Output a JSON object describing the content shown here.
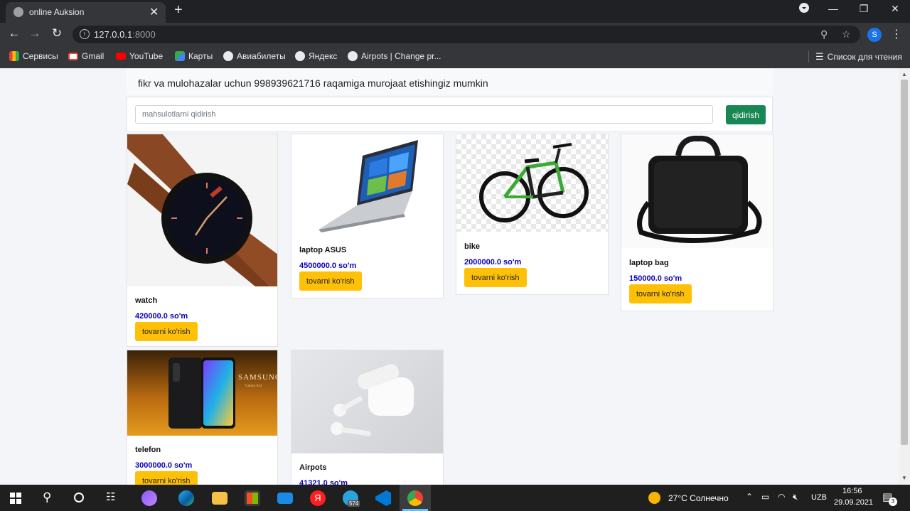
{
  "browser": {
    "tab_title": "online Auksion",
    "url_host": "127.0.0.1",
    "url_port": ":8000",
    "profile_initial": "S",
    "bookmarks": [
      {
        "label": "Сервисы",
        "icon": "apps-grid-icon",
        "color": "#ea4335"
      },
      {
        "label": "Gmail",
        "icon": "gmail-icon",
        "color": "#ea4335"
      },
      {
        "label": "YouTube",
        "icon": "youtube-icon",
        "color": "#ff0000"
      },
      {
        "label": "Карты",
        "icon": "maps-icon",
        "color": "#34a853"
      },
      {
        "label": "Авиабилеты",
        "icon": "globe-icon",
        "color": "#e8eaed"
      },
      {
        "label": "Яндекс",
        "icon": "globe-icon",
        "color": "#e8eaed"
      },
      {
        "label": "Airpots | Change pr...",
        "icon": "globe-icon",
        "color": "#e8eaed"
      }
    ],
    "reading_list": "Список для чтения"
  },
  "page": {
    "notice": "fikr va mulohazalar uchun 998939621716 raqamiga murojaat etishingiz mumkin",
    "search_placeholder": "mahsulotlarni qidirish",
    "search_button": "qidirish",
    "view_button": "tovarni ko'rish",
    "products": [
      {
        "name": "watch",
        "price": "420000.0 so'm"
      },
      {
        "name": "laptop ASUS",
        "price": "4500000.0 so'm"
      },
      {
        "name": "bike",
        "price": "2000000.0 so'm"
      },
      {
        "name": "laptop bag",
        "price": "150000.0 so'm"
      },
      {
        "name": "telefon",
        "price": "3000000.0 so'm"
      },
      {
        "name": "Airpots",
        "price": "41321.0 so'm"
      }
    ],
    "phone_brand": "SAMSUNG",
    "phone_model": "Galaxy A31"
  },
  "taskbar": {
    "weather": "27°C  Солнечно",
    "language": "UZB",
    "time": "16:56",
    "date": "29.09.2021",
    "notification_count": "3",
    "telegram_badge": "574"
  }
}
